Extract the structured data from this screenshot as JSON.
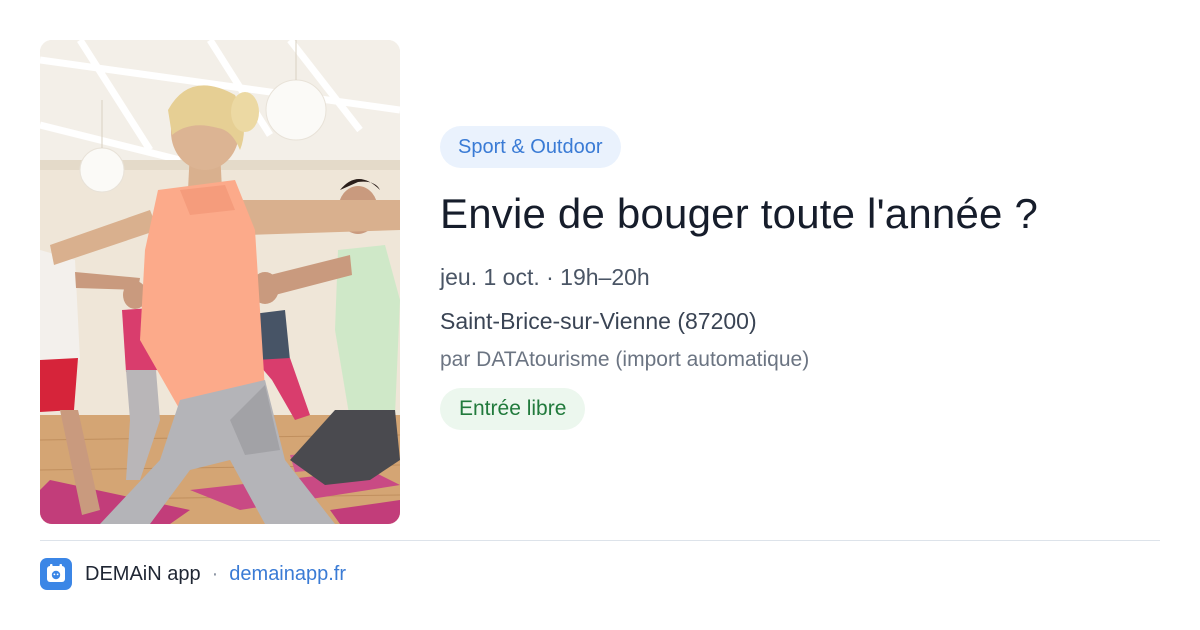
{
  "event": {
    "image": {
      "alt": "yoga-class-photo"
    },
    "category": "Sport & Outdoor",
    "title": "Envie de bouger toute l'année ?",
    "date": "jeu. 1 oct. · 19h–20h",
    "place": "Saint-Brice-sur-Vienne (87200)",
    "source": "par DATAtourisme (import automatique)",
    "price": "Entrée libre"
  },
  "footer": {
    "app_icon": "demain-app-logo-icon",
    "app_name": "DEMAiN app",
    "separator": "·",
    "url": "demainapp.fr"
  },
  "colors": {
    "category_bg": "#eaf2fd",
    "category_text": "#3a7bd5",
    "price_bg": "#ecf7ee",
    "price_text": "#217a3c",
    "brand": "#3b86e6"
  }
}
